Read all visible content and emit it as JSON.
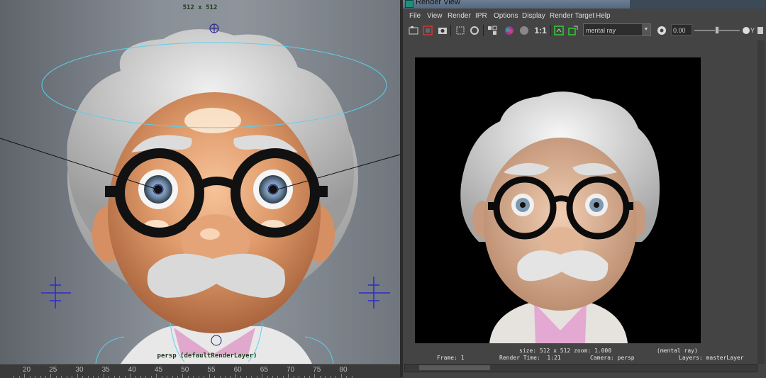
{
  "viewport": {
    "resolution_label": "512 x 512",
    "camera_label": "persp (defaultRenderLayer)"
  },
  "timeline": {
    "ticks": [
      "20",
      "25",
      "30",
      "35",
      "40",
      "45",
      "50",
      "55",
      "60",
      "65",
      "70",
      "75",
      "80"
    ]
  },
  "render_view": {
    "title": "Render View",
    "menus": [
      "File",
      "View",
      "Render",
      "IPR",
      "Options",
      "Display",
      "Render Target",
      "Help"
    ],
    "toolbar": {
      "ratio_label": "1:1",
      "renderer": "mental ray",
      "exposure": "0.00",
      "gamma_label": "Y"
    },
    "hud": {
      "size_line": "size: 512 x 512 zoom: 1.000",
      "renderer_tag": "(mental ray)",
      "frame": "Frame: 1",
      "render_time": "Render Time:  1:21",
      "camera": "Camera: persp",
      "layers": "Layers: masterLayer"
    }
  },
  "icons": [
    "render-frame-icon",
    "ipr-icon",
    "snapshot-icon",
    "region-icon",
    "refresh-icon",
    "rgb-channel-icon",
    "alpha-channel-icon",
    "keep-image-icon",
    "remove-image-icon",
    "gamma-icon"
  ],
  "colors": {
    "accent": "#1f8f7d",
    "skin": "#e5a67c",
    "hair": "#d4d4d4",
    "background": "#444444"
  }
}
